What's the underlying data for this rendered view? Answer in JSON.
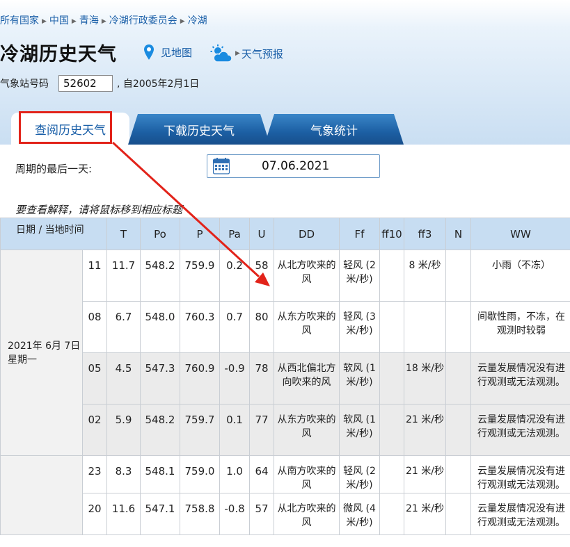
{
  "breadcrumb": [
    "所有国家",
    "中国",
    "青海",
    "冷湖行政委员会",
    "冷湖"
  ],
  "title": "冷湖历史天气",
  "links": {
    "map": "见地图",
    "forecast": "天气预报"
  },
  "station": {
    "label": "气象站号码",
    "value": "52602",
    "since": ", 自2005年2月1日"
  },
  "tabs": [
    {
      "label": "查阅历史天气",
      "active": true
    },
    {
      "label": "下载历史天气",
      "active": false
    },
    {
      "label": "气象统计",
      "active": false
    }
  ],
  "period": {
    "label": "周期的最后一天:",
    "date": "07.06.2021"
  },
  "hint": "要查看解释，请将鼠标移到相应标题",
  "table": {
    "headers": {
      "date": "日期 / 当地时间",
      "T": "T",
      "Po": "Po",
      "P": "P",
      "Pa": "Pa",
      "U": "U",
      "DD": "DD",
      "Ff": "Ff",
      "ff10": "ff10",
      "ff3": "ff3",
      "N": "N",
      "WW": "WW"
    },
    "groups": [
      {
        "date_line1": "2021年 6月 7日",
        "date_line2": "星期一",
        "rows": [
          {
            "time": "11",
            "T": "11.7",
            "Po": "548.2",
            "P": "759.9",
            "Pa": "0.2",
            "U": "58",
            "DD": "从北方吹来的风",
            "Ff": "轻风 (2 米/秒)",
            "ff10": "",
            "ff3": "8 米/秒",
            "N": "",
            "WW": "小雨（不冻）"
          },
          {
            "time": "08",
            "T": "6.7",
            "Po": "548.0",
            "P": "760.3",
            "Pa": "0.7",
            "U": "80",
            "DD": "从东方吹来的风",
            "Ff": "轻风 (3 米/秒)",
            "ff10": "",
            "ff3": "",
            "N": "",
            "WW": "间歇性雨，不冻，在观测时较弱"
          },
          {
            "time": "05",
            "T": "4.5",
            "Po": "547.3",
            "P": "760.9",
            "Pa": "-0.9",
            "U": "78",
            "DD": "从西北偏北方向吹来的风",
            "Ff": "软风 (1 米/秒)",
            "ff10": "",
            "ff3": "18 米/秒",
            "N": "",
            "WW": "云量发展情况没有进行观测或无法观测。"
          },
          {
            "time": "02",
            "T": "5.9",
            "Po": "548.2",
            "P": "759.7",
            "Pa": "0.1",
            "U": "77",
            "DD": "从东方吹来的风",
            "Ff": "软风 (1 米/秒)",
            "ff10": "",
            "ff3": "21 米/秒",
            "N": "",
            "WW": "云量发展情况没有进行观测或无法观测。"
          }
        ]
      },
      {
        "date_line1": "",
        "date_line2": "",
        "rows": [
          {
            "time": "23",
            "T": "8.3",
            "Po": "548.1",
            "P": "759.0",
            "Pa": "1.0",
            "U": "64",
            "DD": "从南方吹来的风",
            "Ff": "轻风 (2 米/秒)",
            "ff10": "",
            "ff3": "21 米/秒",
            "N": "",
            "WW": "云量发展情况没有进行观测或无法观测。"
          },
          {
            "time": "20",
            "T": "11.6",
            "Po": "547.1",
            "P": "758.8",
            "Pa": "-0.8",
            "U": "57",
            "DD": "从北方吹来的风",
            "Ff": "微风 (4 米/秒)",
            "ff10": "",
            "ff3": "21 米/秒",
            "N": "",
            "WW": "云量发展情况没有进行观测或无法观测。"
          }
        ]
      }
    ]
  },
  "colors": {
    "link": "#1a5fa8",
    "highlight": "#e2231a",
    "header_bg": "#c7ddf2",
    "tab_dark": "#1c5fa3"
  }
}
